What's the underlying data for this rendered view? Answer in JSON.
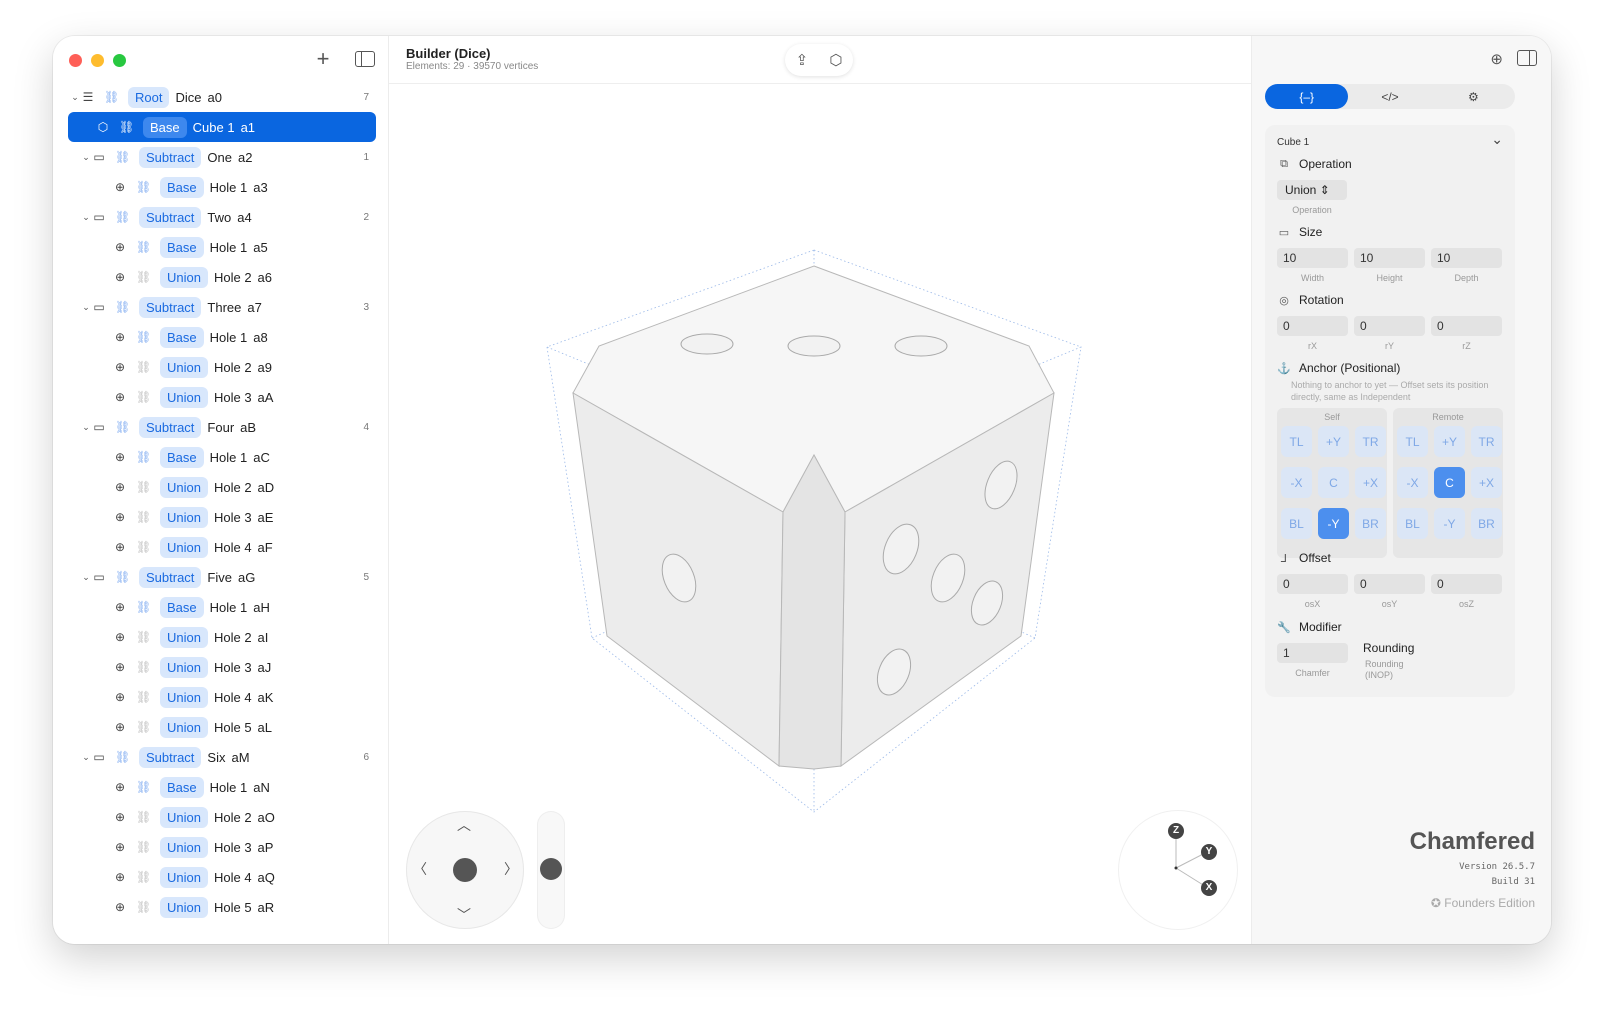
{
  "sidebar": {
    "items": [
      {
        "depth": 0,
        "chev": true,
        "icon": "stack",
        "pill": "Root",
        "name": "Dice",
        "id": "a0",
        "count": "7",
        "selected": false,
        "linkDim": false
      },
      {
        "depth": 1,
        "chev": false,
        "icon": "cube",
        "pill": "Base",
        "name": "Cube 1",
        "id": "a1",
        "count": "",
        "selected": true,
        "linkDim": false
      },
      {
        "depth": 1,
        "chev": true,
        "icon": "folder",
        "pill": "Subtract",
        "name": "One",
        "id": "a2",
        "count": "1",
        "selected": false,
        "linkDim": false
      },
      {
        "depth": 2,
        "chev": false,
        "icon": "globe",
        "pill": "Base",
        "name": "Hole 1",
        "id": "a3",
        "count": "",
        "selected": false,
        "linkDim": false
      },
      {
        "depth": 1,
        "chev": true,
        "icon": "folder",
        "pill": "Subtract",
        "name": "Two",
        "id": "a4",
        "count": "2",
        "selected": false,
        "linkDim": false
      },
      {
        "depth": 2,
        "chev": false,
        "icon": "globe",
        "pill": "Base",
        "name": "Hole 1",
        "id": "a5",
        "count": "",
        "selected": false,
        "linkDim": false
      },
      {
        "depth": 2,
        "chev": false,
        "icon": "globe",
        "pill": "Union",
        "name": "Hole 2",
        "id": "a6",
        "count": "",
        "selected": false,
        "linkDim": true
      },
      {
        "depth": 1,
        "chev": true,
        "icon": "folder",
        "pill": "Subtract",
        "name": "Three",
        "id": "a7",
        "count": "3",
        "selected": false,
        "linkDim": false
      },
      {
        "depth": 2,
        "chev": false,
        "icon": "globe",
        "pill": "Base",
        "name": "Hole 1",
        "id": "a8",
        "count": "",
        "selected": false,
        "linkDim": false
      },
      {
        "depth": 2,
        "chev": false,
        "icon": "globe",
        "pill": "Union",
        "name": "Hole 2",
        "id": "a9",
        "count": "",
        "selected": false,
        "linkDim": true
      },
      {
        "depth": 2,
        "chev": false,
        "icon": "globe",
        "pill": "Union",
        "name": "Hole 3",
        "id": "aA",
        "count": "",
        "selected": false,
        "linkDim": true
      },
      {
        "depth": 1,
        "chev": true,
        "icon": "folder",
        "pill": "Subtract",
        "name": "Four",
        "id": "aB",
        "count": "4",
        "selected": false,
        "linkDim": false
      },
      {
        "depth": 2,
        "chev": false,
        "icon": "globe",
        "pill": "Base",
        "name": "Hole 1",
        "id": "aC",
        "count": "",
        "selected": false,
        "linkDim": false
      },
      {
        "depth": 2,
        "chev": false,
        "icon": "globe",
        "pill": "Union",
        "name": "Hole 2",
        "id": "aD",
        "count": "",
        "selected": false,
        "linkDim": true
      },
      {
        "depth": 2,
        "chev": false,
        "icon": "globe",
        "pill": "Union",
        "name": "Hole 3",
        "id": "aE",
        "count": "",
        "selected": false,
        "linkDim": true
      },
      {
        "depth": 2,
        "chev": false,
        "icon": "globe",
        "pill": "Union",
        "name": "Hole 4",
        "id": "aF",
        "count": "",
        "selected": false,
        "linkDim": true
      },
      {
        "depth": 1,
        "chev": true,
        "icon": "folder",
        "pill": "Subtract",
        "name": "Five",
        "id": "aG",
        "count": "5",
        "selected": false,
        "linkDim": false
      },
      {
        "depth": 2,
        "chev": false,
        "icon": "globe",
        "pill": "Base",
        "name": "Hole 1",
        "id": "aH",
        "count": "",
        "selected": false,
        "linkDim": false
      },
      {
        "depth": 2,
        "chev": false,
        "icon": "globe",
        "pill": "Union",
        "name": "Hole 2",
        "id": "aI",
        "count": "",
        "selected": false,
        "linkDim": true
      },
      {
        "depth": 2,
        "chev": false,
        "icon": "globe",
        "pill": "Union",
        "name": "Hole 3",
        "id": "aJ",
        "count": "",
        "selected": false,
        "linkDim": true
      },
      {
        "depth": 2,
        "chev": false,
        "icon": "globe",
        "pill": "Union",
        "name": "Hole 4",
        "id": "aK",
        "count": "",
        "selected": false,
        "linkDim": true
      },
      {
        "depth": 2,
        "chev": false,
        "icon": "globe",
        "pill": "Union",
        "name": "Hole 5",
        "id": "aL",
        "count": "",
        "selected": false,
        "linkDim": true
      },
      {
        "depth": 1,
        "chev": true,
        "icon": "folder",
        "pill": "Subtract",
        "name": "Six",
        "id": "aM",
        "count": "6",
        "selected": false,
        "linkDim": false
      },
      {
        "depth": 2,
        "chev": false,
        "icon": "globe",
        "pill": "Base",
        "name": "Hole 1",
        "id": "aN",
        "count": "",
        "selected": false,
        "linkDim": false
      },
      {
        "depth": 2,
        "chev": false,
        "icon": "globe",
        "pill": "Union",
        "name": "Hole 2",
        "id": "aO",
        "count": "",
        "selected": false,
        "linkDim": true
      },
      {
        "depth": 2,
        "chev": false,
        "icon": "globe",
        "pill": "Union",
        "name": "Hole 3",
        "id": "aP",
        "count": "",
        "selected": false,
        "linkDim": true
      },
      {
        "depth": 2,
        "chev": false,
        "icon": "globe",
        "pill": "Union",
        "name": "Hole 4",
        "id": "aQ",
        "count": "",
        "selected": false,
        "linkDim": true
      },
      {
        "depth": 2,
        "chev": false,
        "icon": "globe",
        "pill": "Union",
        "name": "Hole 5",
        "id": "aR",
        "count": "",
        "selected": false,
        "linkDim": true
      }
    ]
  },
  "header": {
    "title": "Builder (Dice)",
    "subtitle": "Elements: 29 · 39570 vertices"
  },
  "viewport": {
    "axes": {
      "z": "Z",
      "y": "Y",
      "x": "X"
    }
  },
  "inspector": {
    "tabs": [
      "{–}",
      "</>",
      "⚙"
    ],
    "active_tab": 0,
    "card_title": "Cube 1",
    "operation": {
      "label": "Operation",
      "value": "Union",
      "caption": "Operation"
    },
    "size": {
      "label": "Size",
      "width": "10",
      "height": "10",
      "depth": "10",
      "caps": [
        "Width",
        "Height",
        "Depth"
      ]
    },
    "rotation": {
      "label": "Rotation",
      "rx": "0",
      "ry": "0",
      "rz": "0",
      "caps": [
        "rX",
        "rY",
        "rZ"
      ]
    },
    "anchor": {
      "label": "Anchor (Positional)",
      "note": "Nothing to anchor to yet — Offset sets its position directly, same as Independent",
      "self_label": "Self",
      "remote_label": "Remote",
      "grid": [
        "TL",
        "+Y",
        "TR",
        "-X",
        "C",
        "+X",
        "BL",
        "-Y",
        "BR"
      ],
      "self_active": "-Y",
      "remote_active": "C"
    },
    "offset": {
      "label": "Offset",
      "x": "0",
      "y": "0",
      "z": "0",
      "caps": [
        "osX",
        "osY",
        "osZ"
      ]
    },
    "modifier": {
      "label": "Modifier",
      "chamfer": "1",
      "chamfer_cap": "Chamfer",
      "rounding_label": "Rounding",
      "rounding_cap": "Rounding (INOP)"
    }
  },
  "brand": {
    "name": "Chamfered",
    "version": "Version 26.5.7",
    "build": "Build 31",
    "edition": "Founders Edition"
  },
  "colors": {
    "accent": "#0a66e0",
    "pill_bg": "#d8e7fc",
    "pill_fg": "#1a6ae0"
  }
}
